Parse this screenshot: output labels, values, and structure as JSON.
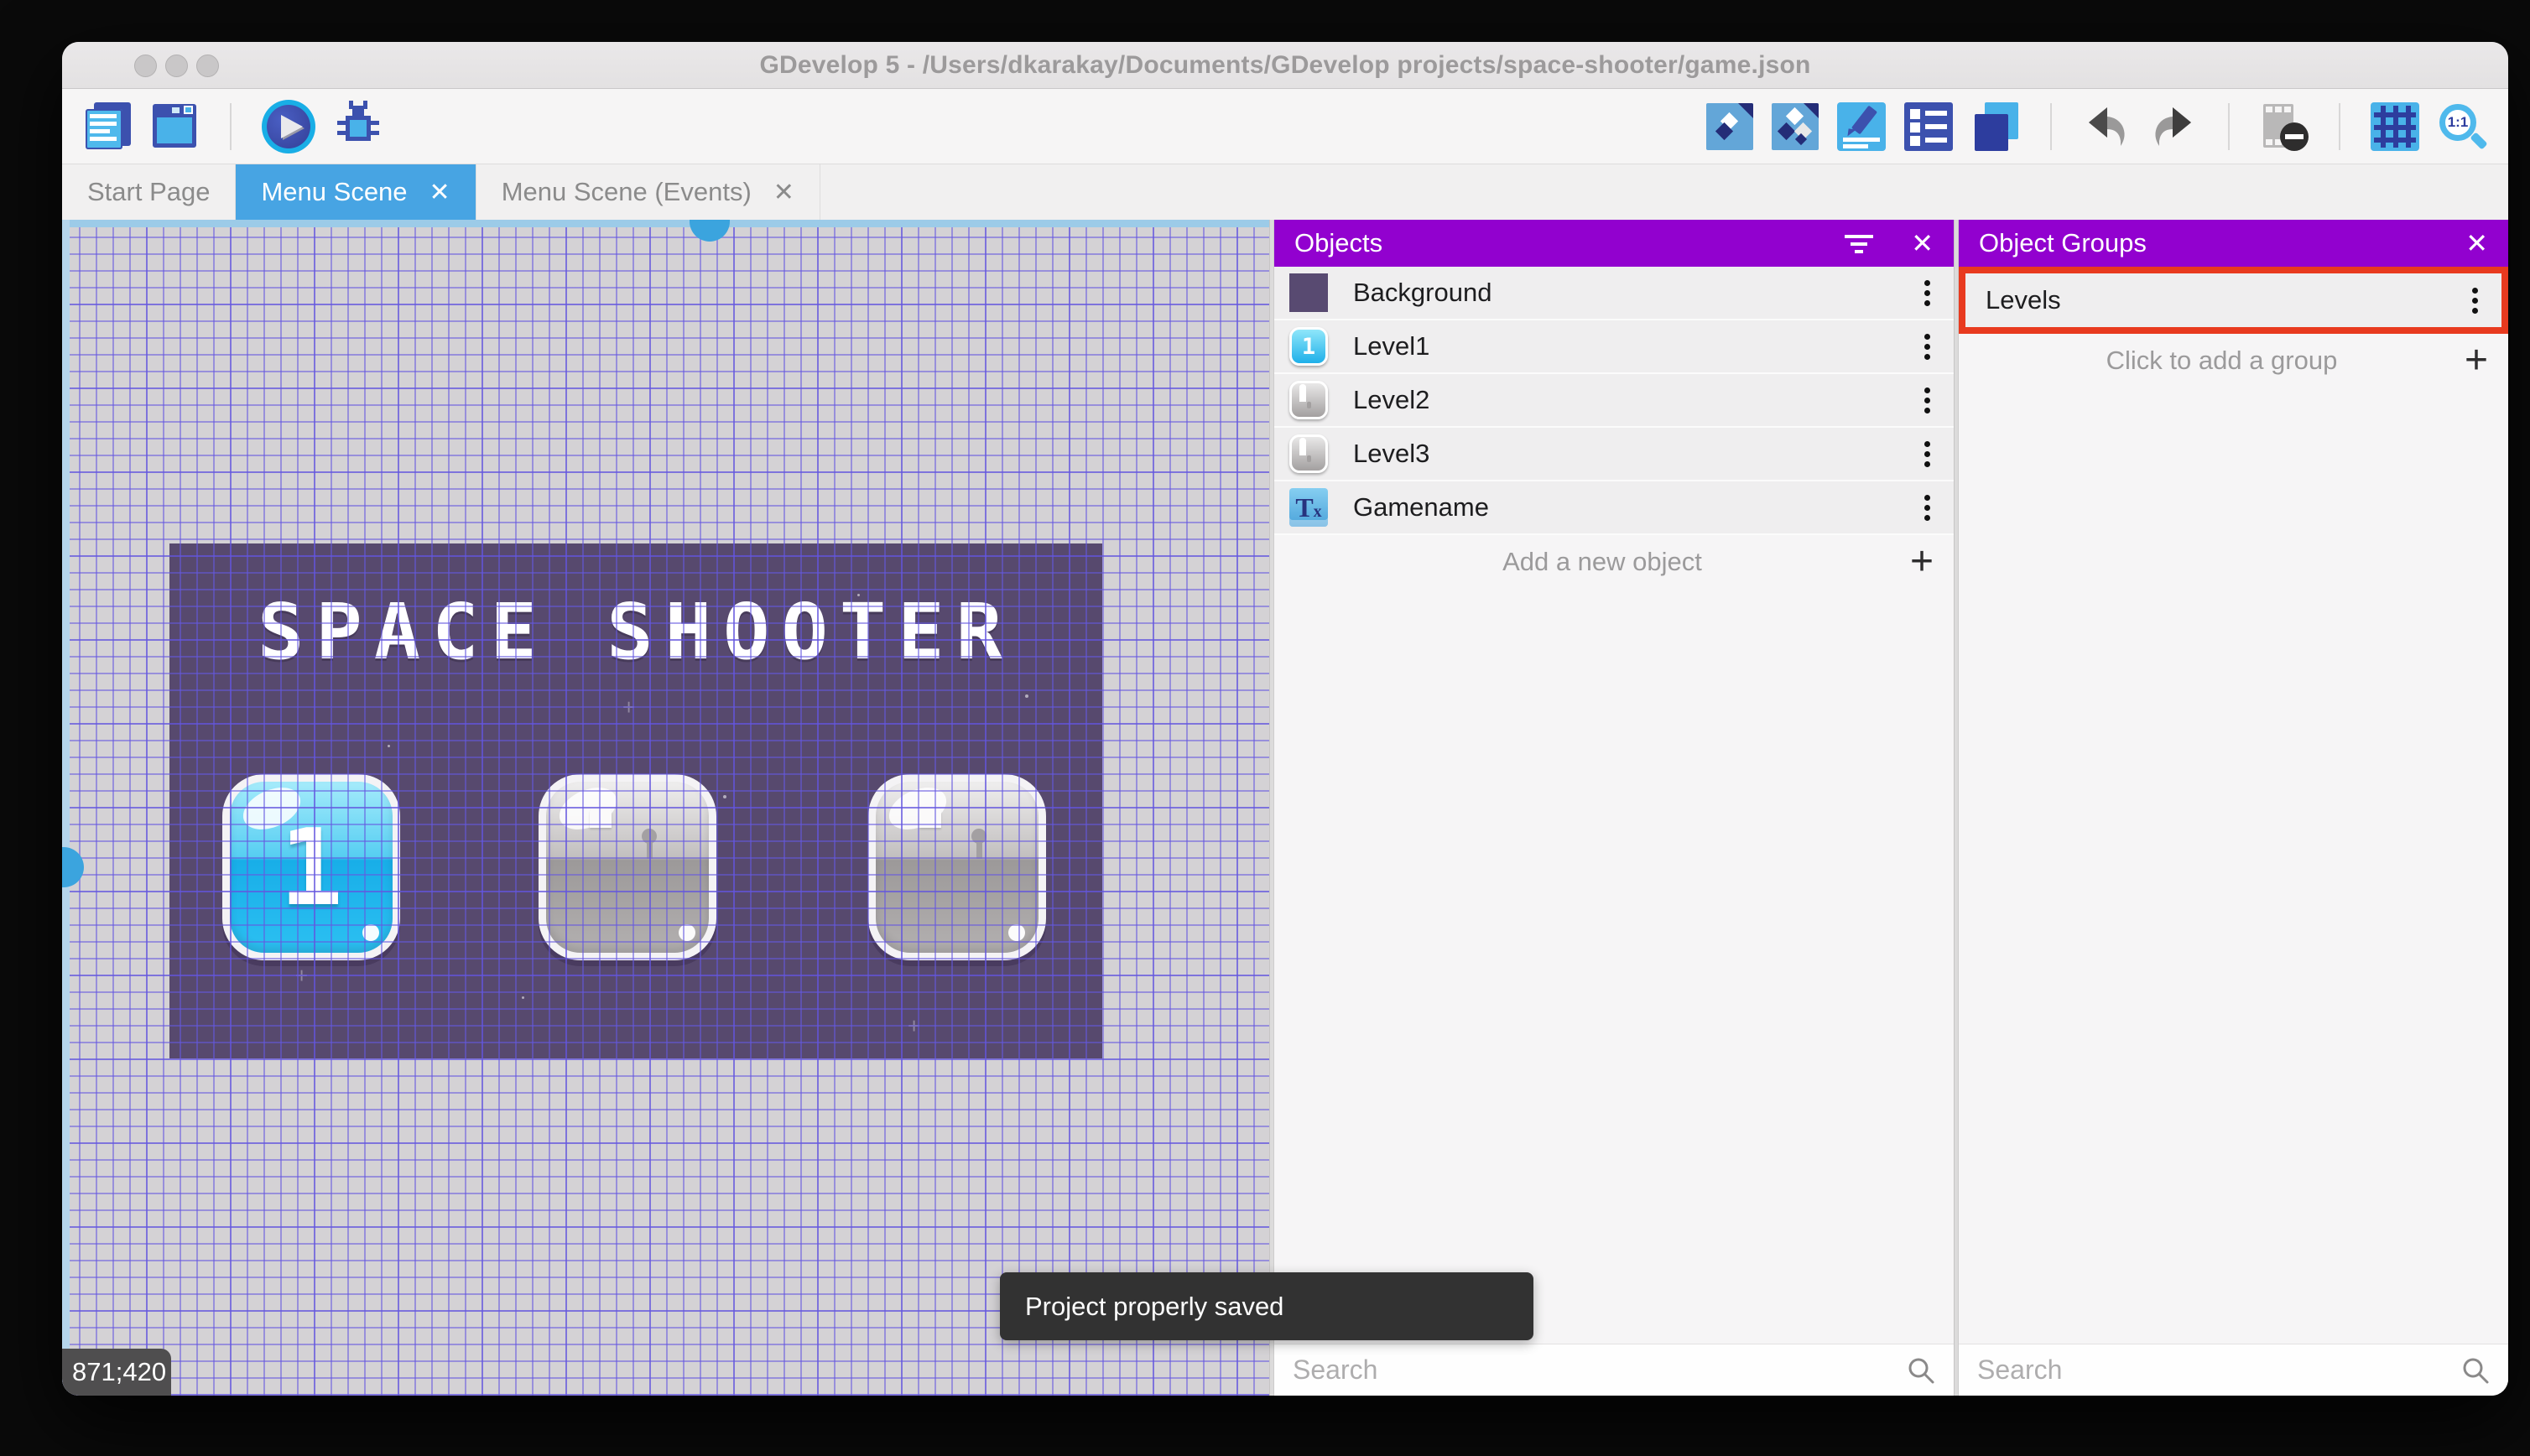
{
  "window": {
    "title": "GDevelop 5 - /Users/dkarakay/Documents/GDevelop projects/space-shooter/game.json"
  },
  "toolbar": {
    "left_icons": [
      "project-manager",
      "preview-window",
      "play-preview",
      "debug"
    ],
    "right_icons": [
      "scene-objects",
      "object-groups",
      "scene-properties",
      "instances-list",
      "layers",
      "undo",
      "redo",
      "toggle-mask",
      "grid",
      "zoom-1-1"
    ],
    "zoom_label": "1:1"
  },
  "tabs": [
    {
      "label": "Start Page",
      "active": false,
      "closable": false
    },
    {
      "label": "Menu Scene",
      "active": true,
      "closable": true
    },
    {
      "label": "Menu Scene (Events)",
      "active": false,
      "closable": true
    }
  ],
  "scene": {
    "title": "SPACE SHOOTER",
    "coordinates": "871;420",
    "buttons": [
      {
        "label": "1",
        "state": "unlocked"
      },
      {
        "label": "",
        "state": "locked"
      },
      {
        "label": "",
        "state": "locked"
      }
    ]
  },
  "objects_panel": {
    "title": "Objects",
    "items": [
      {
        "name": "Background",
        "icon": "background-sprite"
      },
      {
        "name": "Level1",
        "icon": "level-button-unlocked"
      },
      {
        "name": "Level2",
        "icon": "level-button-locked"
      },
      {
        "name": "Level3",
        "icon": "level-button-locked"
      },
      {
        "name": "Gamename",
        "icon": "text-object"
      }
    ],
    "add_label": "Add a new object",
    "search_placeholder": "Search"
  },
  "groups_panel": {
    "title": "Object Groups",
    "items": [
      {
        "name": "Levels",
        "highlighted": true
      }
    ],
    "add_label": "Click to add a group",
    "search_placeholder": "Search"
  },
  "toast": {
    "message": "Project properly saved"
  },
  "colors": {
    "panel_header": "#9201cf",
    "active_tab": "#47a4e3",
    "highlight_border": "#e83a1f",
    "scene_background": "#57496e",
    "grid_line": "#6558e0",
    "toast_background": "#323232"
  }
}
